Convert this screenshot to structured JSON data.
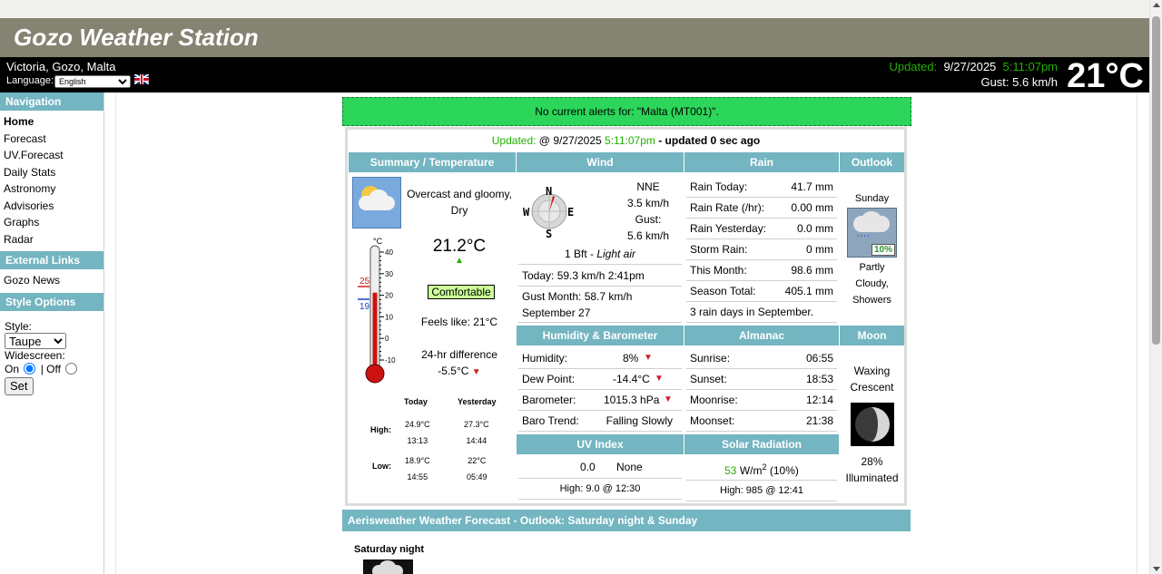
{
  "site": {
    "title": "Gozo Weather Station",
    "location": "Victoria, Gozo, Malta",
    "language_label": "Language:",
    "language_value": "English",
    "updated_label": "Updated:",
    "updated_date": "9/27/2025",
    "updated_time": "5:11:07pm",
    "gust_text": "Gust: 5.6 km/h",
    "current_temp": "21°C"
  },
  "nav": {
    "heading": "Navigation",
    "items": [
      "Home",
      "Forecast",
      "UV.Forecast",
      "Daily Stats",
      "Astronomy",
      "Advisories",
      "Graphs",
      "Radar"
    ],
    "external_heading": "External Links",
    "external_items": [
      "Gozo News"
    ],
    "style_heading": "Style Options",
    "style_label": "Style:",
    "style_value": "Taupe",
    "widescreen_label": "Widescreen:",
    "on_label": "On",
    "off_label": "| Off",
    "set_label": "Set"
  },
  "alert": "No current alerts for: \"Malta (MT001)\".",
  "updated_line": {
    "label": "Updated:",
    "date": "@ 9/27/2025",
    "time": "5:11:07pm",
    "ago": "- updated 0 sec ago"
  },
  "summary": {
    "heading": "Summary / Temperature",
    "condition": "Overcast and gloomy, Dry",
    "temp": "21.2°C",
    "comfort": "Comfortable",
    "feels_like": "Feels like: 21°C",
    "diff_label": "24-hr difference",
    "diff_value": "-5.5°C",
    "thermo_unit": "°C",
    "thermo_high": "25",
    "thermo_low": "19",
    "thermo_ticks": [
      "40",
      "30",
      "20",
      "10",
      "0",
      "-10"
    ],
    "thermo_level_c": 21.2,
    "table": {
      "today": "Today",
      "yesterday": "Yesterday",
      "high_label": "High:",
      "low_label": "Low:",
      "high_today_val": "24.9°C",
      "high_today_time": "13:13",
      "high_yest_val": "27.3°C",
      "high_yest_time": "14:44",
      "low_today_val": "18.9°C",
      "low_today_time": "14:55",
      "low_yest_val": "22°C",
      "low_yest_time": "05:49"
    }
  },
  "wind": {
    "heading": "Wind",
    "direction": "NNE",
    "speed": "3.5 km/h",
    "gust_label": "Gust:",
    "gust": "5.6 km/h",
    "compass": {
      "n": "N",
      "s": "S",
      "e": "E",
      "w": "W"
    },
    "bft": "1 Bft - ",
    "bft_desc": "Light air",
    "today": "Today: 59.3 km/h 2:41pm",
    "gust_month": "Gust Month: 58.7 km/h",
    "gust_month_date": "September 27"
  },
  "rain": {
    "heading": "Rain",
    "rows": [
      {
        "label": "Rain Today:",
        "value": "41.7 mm"
      },
      {
        "label": "Rain Rate (/hr):",
        "value": "0.00 mm"
      },
      {
        "label": "Rain Yesterday:",
        "value": "0.0 mm"
      },
      {
        "label": "Storm Rain:",
        "value": "0 mm"
      },
      {
        "label": "This Month:",
        "value": "98.6 mm"
      },
      {
        "label": "Season Total:",
        "value": "405.1 mm"
      }
    ],
    "days_note": "3 rain days in September."
  },
  "outlook": {
    "heading": "Outlook",
    "day": "Sunday",
    "pop": "10%",
    "desc1": "Partly",
    "desc2": "Cloudy,",
    "desc3": "Showers"
  },
  "humidity": {
    "heading": "Humidity & Barometer",
    "rows": [
      {
        "label": "Humidity:",
        "value": "8%"
      },
      {
        "label": "Dew Point:",
        "value": "-14.4°C"
      },
      {
        "label": "Barometer:",
        "value": "1015.3 hPa"
      },
      {
        "label": "Baro Trend:",
        "value": "Falling Slowly"
      }
    ]
  },
  "almanac": {
    "heading": "Almanac",
    "rows": [
      {
        "label": "Sunrise:",
        "value": "06:55"
      },
      {
        "label": "Sunset:",
        "value": "18:53"
      },
      {
        "label": "Moonrise:",
        "value": "12:14"
      },
      {
        "label": "Moonset:",
        "value": "21:38"
      }
    ]
  },
  "moon": {
    "heading": "Moon",
    "phase1": "Waxing",
    "phase2": "Crescent",
    "illum_pct": "28%",
    "illum_label": "Illuminated"
  },
  "uv": {
    "heading": "UV Index",
    "value": "0.0",
    "level": "None",
    "high": "High: 9.0 @ 12:30"
  },
  "solar": {
    "heading": "Solar Radiation",
    "value": "53",
    "unit": "W/m",
    "sup": "2",
    "pct": "(10%)",
    "high": "High: 985 @  12:41"
  },
  "forecast": {
    "heading": "Aerisweather Weather Forecast  - Outlook: Saturday night & Sunday",
    "period": "Saturday night"
  }
}
